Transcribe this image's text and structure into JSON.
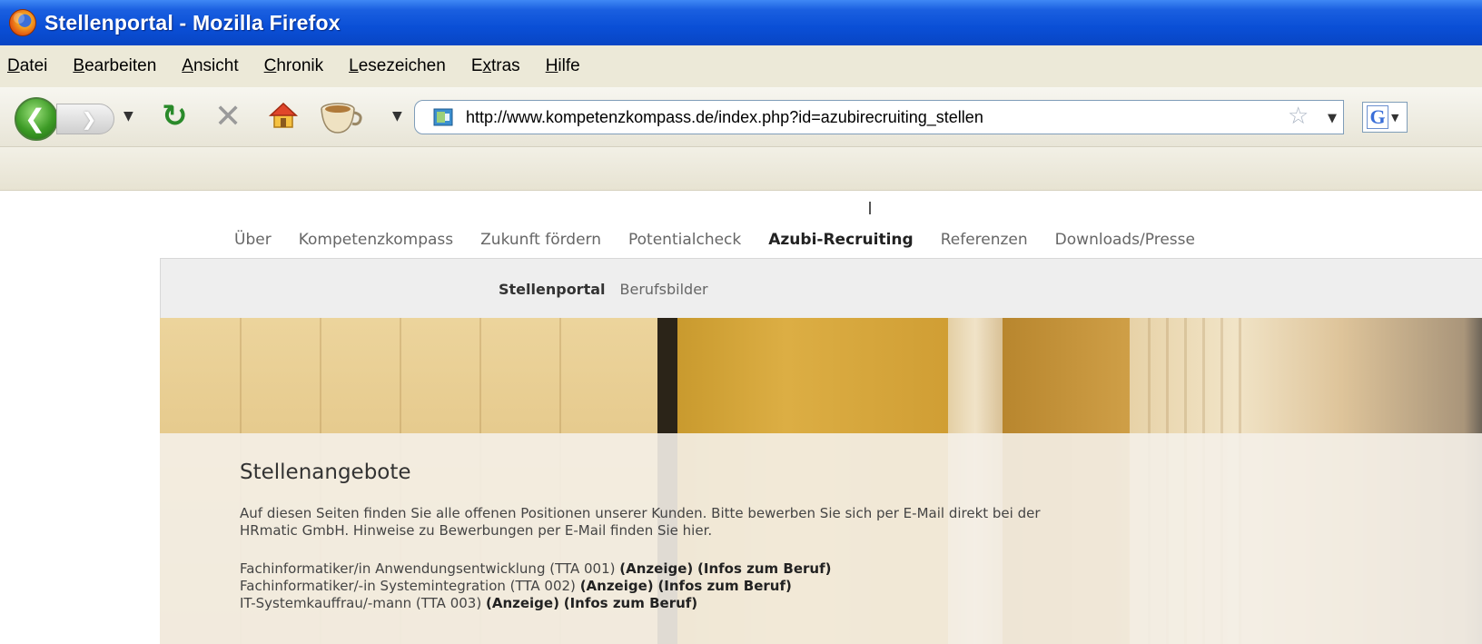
{
  "window": {
    "title": "Stellenportal - Mozilla Firefox"
  },
  "menubar": {
    "items": [
      {
        "key": "D",
        "rest": "atei"
      },
      {
        "key": "B",
        "rest": "earbeiten"
      },
      {
        "key": "A",
        "rest": "nsicht"
      },
      {
        "key": "C",
        "rest": "hronik"
      },
      {
        "key": "L",
        "rest": "esezeichen"
      },
      {
        "pre": "E",
        "key": "x",
        "rest": "tras"
      },
      {
        "key": "H",
        "rest": "ilfe"
      }
    ]
  },
  "toolbar": {
    "url": "http://www.kompetenzkompass.de/index.php?id=azubirecruiting_stellen",
    "search_engine": "G"
  },
  "page": {
    "main_nav": [
      {
        "label": "Über",
        "active": false
      },
      {
        "label": "Kompetenzkompass",
        "active": false
      },
      {
        "label": "Zukunft fördern",
        "active": false
      },
      {
        "label": "Potentialcheck",
        "active": false
      },
      {
        "label": "Azubi-Recruiting",
        "active": true
      },
      {
        "label": "Referenzen",
        "active": false
      },
      {
        "label": "Downloads/Presse",
        "active": false
      }
    ],
    "sub_nav": [
      {
        "label": "Stellenportal",
        "active": true
      },
      {
        "label": "Berufsbilder",
        "active": false
      }
    ],
    "heading": "Stellenangebote",
    "intro_line1": "Auf diesen Seiten finden Sie alle offenen Positionen unserer Kunden. Bitte bewerben Sie sich per E-Mail direkt bei der",
    "intro_line2": "HRmatic GmbH. Hinweise zu Bewerbungen per E-Mail finden Sie hier.",
    "jobs": [
      {
        "title": "Fachinformatiker/in Anwendungsentwicklung (TTA 001)",
        "ad_link": "(Anzeige)",
        "info_link": "(Infos zum Beruf)"
      },
      {
        "title": "Fachinformatiker/-in Systemintegration (TTA 002)",
        "ad_link": "(Anzeige)",
        "info_link": "(Infos zum Beruf)"
      },
      {
        "title": "IT-Systemkauffrau/-mann (TTA 003)",
        "ad_link": "(Anzeige)",
        "info_link": "(Infos zum Beruf)"
      }
    ]
  }
}
